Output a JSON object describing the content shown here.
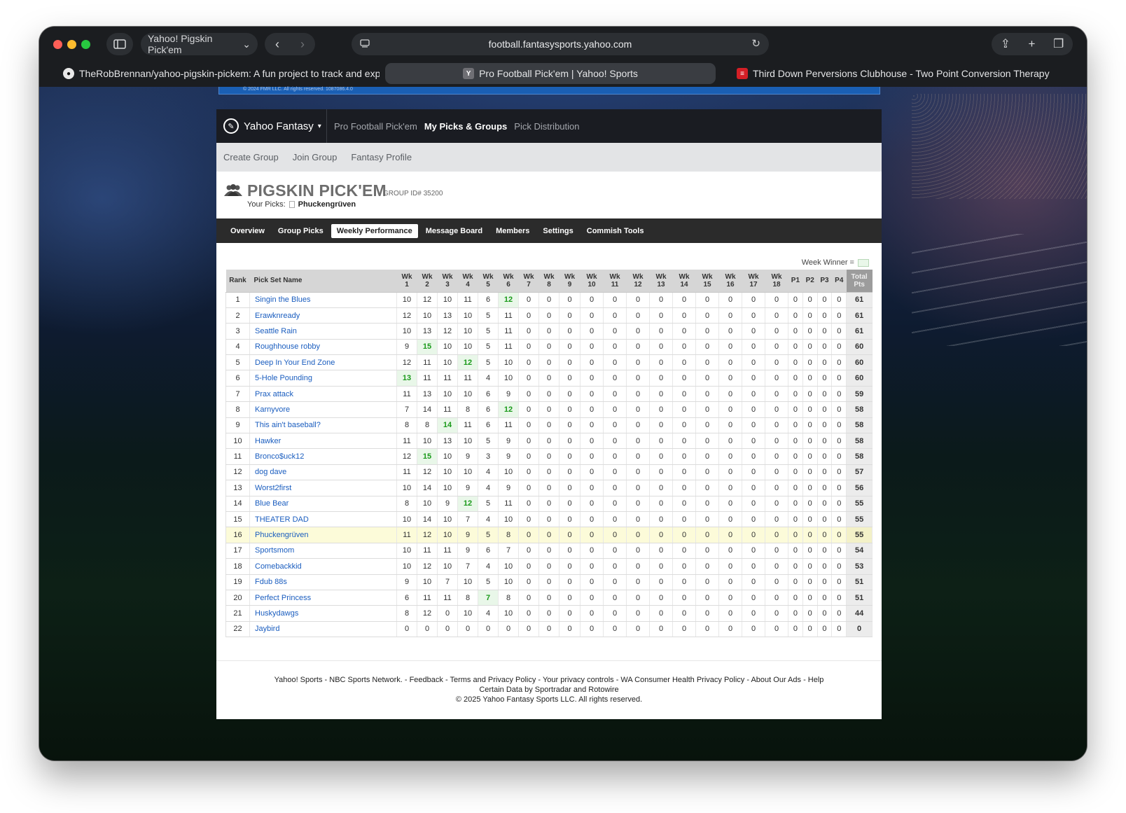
{
  "browser": {
    "tab_group_label": "Yahoo! Pigskin Pick'em",
    "url": "football.fantasysports.yahoo.com",
    "tabs": [
      {
        "title": "TheRobBrennan/yahoo-pigskin-pickem: A fun project to track and exp...",
        "favicon": "github-icon"
      },
      {
        "title": "Pro Football Pick'em | Yahoo! Sports",
        "favicon": "Y"
      },
      {
        "title": "Third Down Perversions Clubhouse - Two Point Conversion Therapy -...",
        "favicon": "sports-icon"
      }
    ]
  },
  "yahoo_nav": {
    "brand": "Yahoo Fantasy",
    "links": [
      "Pro Football Pick'em",
      "My Picks & Groups",
      "Pick Distribution"
    ],
    "active": "My Picks & Groups"
  },
  "subnav": [
    "Create Group",
    "Join Group",
    "Fantasy Profile"
  ],
  "group": {
    "title": "PIGSKIN PICK'EM",
    "id_text": "GROUP ID# 35200",
    "your_picks_label": "Your Picks:",
    "your_picks_name": "Phuckengrüven"
  },
  "group_tabs": [
    "Overview",
    "Group Picks",
    "Weekly Performance",
    "Message Board",
    "Members",
    "Settings",
    "Commish Tools"
  ],
  "selected_tab": "Weekly Performance",
  "legend_label": "Week Winner =",
  "colors": {
    "week_winner_bg": "#e9f7e9",
    "week_winner_text": "#1a9a1a",
    "my_row_bg": "#fcfbd9",
    "link": "#1a5dbf"
  },
  "table": {
    "rank_header": "Rank",
    "name_header": "Pick Set Name",
    "week_headers": [
      [
        "Wk",
        "1"
      ],
      [
        "Wk",
        "2"
      ],
      [
        "Wk",
        "3"
      ],
      [
        "Wk",
        "4"
      ],
      [
        "Wk",
        "5"
      ],
      [
        "Wk",
        "6"
      ],
      [
        "Wk",
        "7"
      ],
      [
        "Wk",
        "8"
      ],
      [
        "Wk",
        "9"
      ],
      [
        "Wk",
        "10"
      ],
      [
        "Wk",
        "11"
      ],
      [
        "Wk",
        "12"
      ],
      [
        "Wk",
        "13"
      ],
      [
        "Wk",
        "14"
      ],
      [
        "Wk",
        "15"
      ],
      [
        "Wk",
        "16"
      ],
      [
        "Wk",
        "17"
      ],
      [
        "Wk",
        "18"
      ]
    ],
    "playoff_headers": [
      "P1",
      "P2",
      "P3",
      "P4"
    ],
    "total_header": [
      "Total",
      "Pts"
    ],
    "rows": [
      {
        "rank": "1",
        "name": "Singin the Blues",
        "weeks": [
          10,
          12,
          10,
          11,
          6,
          12
        ],
        "winners": [
          5
        ],
        "total": "61"
      },
      {
        "rank": "2",
        "name": "Erawknready",
        "weeks": [
          12,
          10,
          13,
          10,
          5,
          11
        ],
        "winners": [],
        "total": "61"
      },
      {
        "rank": "3",
        "name": "Seattle Rain",
        "weeks": [
          10,
          13,
          12,
          10,
          5,
          11
        ],
        "winners": [],
        "total": "61"
      },
      {
        "rank": "4",
        "name": "Roughhouse robby",
        "weeks": [
          9,
          15,
          10,
          10,
          5,
          11
        ],
        "winners": [
          1
        ],
        "total": "60"
      },
      {
        "rank": "5",
        "name": "Deep In Your End Zone",
        "weeks": [
          12,
          11,
          10,
          12,
          5,
          10
        ],
        "winners": [
          3
        ],
        "total": "60"
      },
      {
        "rank": "6",
        "name": "5-Hole Pounding",
        "weeks": [
          13,
          11,
          11,
          11,
          4,
          10
        ],
        "winners": [
          0
        ],
        "total": "60"
      },
      {
        "rank": "7",
        "name": "Prax attack",
        "weeks": [
          11,
          13,
          10,
          10,
          6,
          9
        ],
        "winners": [],
        "total": "59"
      },
      {
        "rank": "8",
        "name": "Karnyvore",
        "weeks": [
          7,
          14,
          11,
          8,
          6,
          12
        ],
        "winners": [
          5
        ],
        "total": "58"
      },
      {
        "rank": "9",
        "name": "This ain't baseball?",
        "weeks": [
          8,
          8,
          14,
          11,
          6,
          11
        ],
        "winners": [
          2
        ],
        "total": "58"
      },
      {
        "rank": "10",
        "name": "Hawker",
        "weeks": [
          11,
          10,
          13,
          10,
          5,
          9
        ],
        "winners": [],
        "total": "58"
      },
      {
        "rank": "11",
        "name": "Bronco$uck12",
        "weeks": [
          12,
          15,
          10,
          9,
          3,
          9
        ],
        "winners": [
          1
        ],
        "total": "58"
      },
      {
        "rank": "12",
        "name": "dog dave",
        "weeks": [
          11,
          12,
          10,
          10,
          4,
          10
        ],
        "winners": [],
        "total": "57"
      },
      {
        "rank": "13",
        "name": "Worst2first",
        "weeks": [
          10,
          14,
          10,
          9,
          4,
          9
        ],
        "winners": [],
        "total": "56"
      },
      {
        "rank": "14",
        "name": "Blue Bear",
        "weeks": [
          8,
          10,
          9,
          12,
          5,
          11
        ],
        "winners": [
          3
        ],
        "total": "55"
      },
      {
        "rank": "15",
        "name": "THEATER DAD",
        "weeks": [
          10,
          14,
          10,
          7,
          4,
          10
        ],
        "winners": [],
        "total": "55"
      },
      {
        "rank": "16",
        "name": "Phuckengrüven",
        "weeks": [
          11,
          12,
          10,
          9,
          5,
          8
        ],
        "winners": [],
        "total": "55",
        "mine": true
      },
      {
        "rank": "17",
        "name": "Sportsmom",
        "weeks": [
          10,
          11,
          11,
          9,
          6,
          7
        ],
        "winners": [],
        "total": "54"
      },
      {
        "rank": "18",
        "name": "Comebackkid",
        "weeks": [
          10,
          12,
          10,
          7,
          4,
          10
        ],
        "winners": [],
        "total": "53"
      },
      {
        "rank": "19",
        "name": "Fdub 88s",
        "weeks": [
          9,
          10,
          7,
          10,
          5,
          10
        ],
        "winners": [],
        "total": "51"
      },
      {
        "rank": "20",
        "name": "Perfect Princess",
        "weeks": [
          6,
          11,
          11,
          8,
          7,
          8
        ],
        "winners": [
          4
        ],
        "total": "51"
      },
      {
        "rank": "21",
        "name": "Huskydawgs",
        "weeks": [
          8,
          12,
          0,
          10,
          4,
          10
        ],
        "winners": [],
        "total": "44"
      },
      {
        "rank": "22",
        "name": "Jaybird",
        "weeks": [
          0,
          0,
          0,
          0,
          0,
          0
        ],
        "winners": [],
        "total": "0"
      }
    ]
  },
  "footer": {
    "line1_parts": [
      "Yahoo! Sports",
      " - ",
      "NBC Sports Network.",
      " - ",
      "Feedback",
      " - ",
      "Terms and ",
      "Privacy Policy",
      " - ",
      "Your privacy controls",
      " - ",
      "WA Consumer Health Privacy Policy",
      " - ",
      "About Our Ads",
      " - ",
      "Help"
    ],
    "line2": "Certain Data by Sportradar and Rotowire",
    "line3": "© 2025 Yahoo Fantasy Sports LLC. All rights reserved."
  },
  "strip_text": "© 2024 FMR LLC. All rights reserved. 1087086.4.0"
}
